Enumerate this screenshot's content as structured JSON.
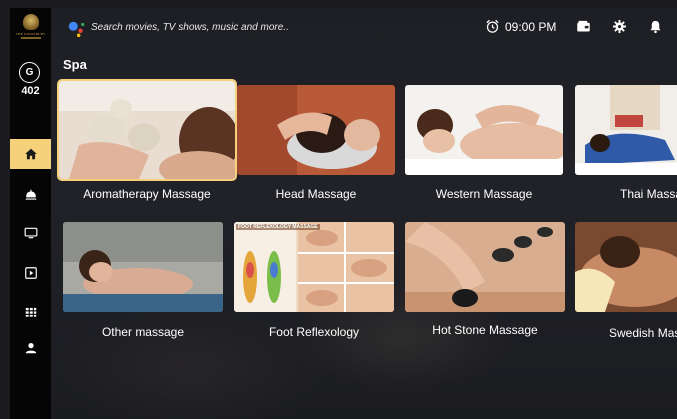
{
  "brand": {
    "name": "THE KINGSBURY"
  },
  "user": {
    "initial": "G",
    "room": "402"
  },
  "sidebar": {
    "items": [
      {
        "name": "home",
        "active": true
      },
      {
        "name": "room-service"
      },
      {
        "name": "tv"
      },
      {
        "name": "movies"
      },
      {
        "name": "apps"
      },
      {
        "name": "profile"
      }
    ]
  },
  "header": {
    "search_placeholder": "Search movies, TV shows, music and more..",
    "time": "09:00 PM"
  },
  "section": {
    "title": "Spa"
  },
  "cards": [
    {
      "label": "Aromatherapy Massage",
      "selected": true
    },
    {
      "label": "Head Massage"
    },
    {
      "label": "Western Massage"
    },
    {
      "label": "Thai Massa"
    },
    {
      "label": "Other massage"
    },
    {
      "label": "Foot Reflexology",
      "overlay": "FOOT REFLEXOLOGY MASSAGE"
    },
    {
      "label": "Hot Stone Massage"
    },
    {
      "label": "Swedish Mas"
    }
  ],
  "colors": {
    "accent": "#f6d17b",
    "sidebar": "#050505",
    "background": "#1e1f24"
  }
}
